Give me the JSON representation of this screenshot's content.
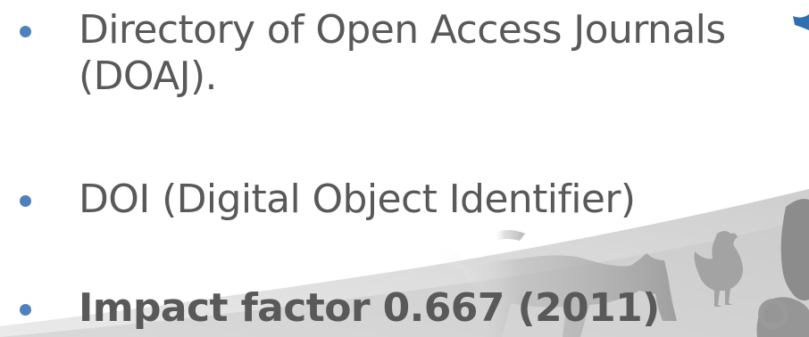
{
  "slide": {
    "bullets": [
      {
        "text": "Directory of Open Access Journals",
        "continuation": "(DOAJ).",
        "bold": false
      },
      {
        "text": "DOI (Digital Object Identifier)",
        "bold": false
      },
      {
        "text": "Impact factor 0.667 (2011)",
        "bold": true
      }
    ]
  },
  "colors": {
    "bullet": "#4f81bd",
    "text": "#595959",
    "silhouette": "#8c8c8c",
    "accent_ribbon": "#2f6fb0"
  },
  "icons": [
    "cow-silhouette-icon",
    "rooster-silhouette-icon",
    "sheep-silhouette-icon"
  ]
}
